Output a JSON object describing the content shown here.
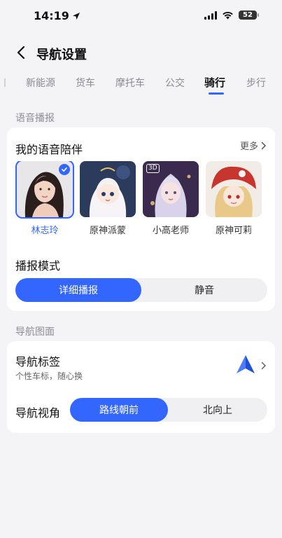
{
  "status": {
    "time": "14:19",
    "battery": "52"
  },
  "header": {
    "title": "导航设置"
  },
  "tabs": [
    {
      "label": "新能源"
    },
    {
      "label": "货车"
    },
    {
      "label": "摩托车"
    },
    {
      "label": "公交"
    },
    {
      "label": "骑行"
    },
    {
      "label": "步行"
    }
  ],
  "voice_section": {
    "label": "语音播报",
    "companion_title": "我的语音陪伴",
    "more_label": "更多",
    "voices": [
      {
        "name": "林志玲",
        "selected": true
      },
      {
        "name": "原神派蒙",
        "selected": false
      },
      {
        "name": "小高老师",
        "selected": false
      },
      {
        "name": "原神可莉",
        "selected": false
      }
    ],
    "badge_3d": "3D",
    "mode_title": "播报模式",
    "mode_options": [
      {
        "label": "详细播报",
        "active": true
      },
      {
        "label": "静音",
        "active": false
      }
    ]
  },
  "nav_section": {
    "label": "导航图面",
    "tag_title": "导航标签",
    "tag_subtitle": "个性车标，随心换",
    "view_title": "导航视角",
    "view_options": [
      {
        "label": "路线朝前",
        "active": true
      },
      {
        "label": "北向上",
        "active": false
      }
    ]
  },
  "colors": {
    "accent": "#3366ff",
    "background": "#f4f4f6",
    "card": "#ffffff"
  }
}
